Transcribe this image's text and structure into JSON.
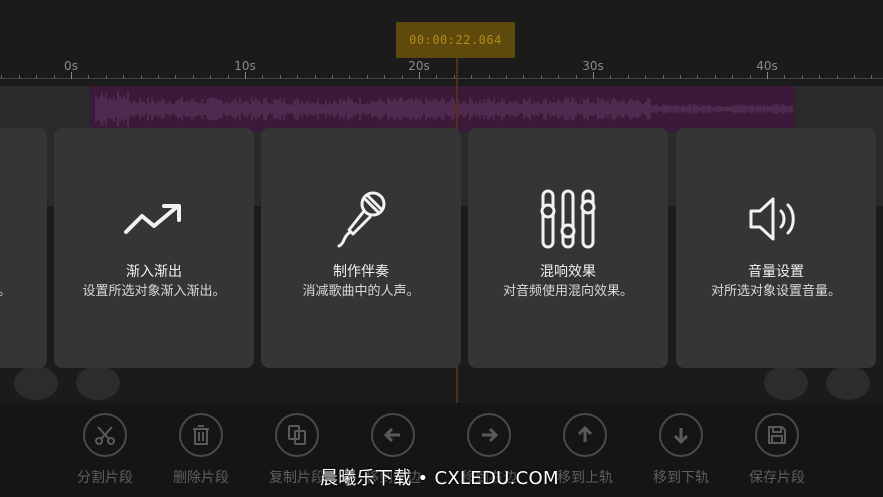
{
  "timeline": {
    "current_time": "00:00:22.064",
    "ruler_labels": [
      "0s",
      "10s",
      "20s",
      "30s",
      "40s"
    ]
  },
  "cards": [
    {
      "icon": "trend-up-icon",
      "title": "渐入渐出",
      "description": "设置所选对象渐入渐出。"
    },
    {
      "icon": "microphone-icon",
      "title": "制作伴奏",
      "description": "消减歌曲中的人声。"
    },
    {
      "icon": "sliders-icon",
      "title": "混响效果",
      "description": "对音频使用混向效果。"
    },
    {
      "icon": "speaker-icon",
      "title": "音量设置",
      "description": "对所选对象设置音量。"
    }
  ],
  "partial_card_text": "调。",
  "toolbar": [
    {
      "icon": "scissors-icon",
      "label": "分割片段"
    },
    {
      "icon": "trash-icon",
      "label": "删除片段"
    },
    {
      "icon": "copy-icon",
      "label": "复制片段"
    },
    {
      "icon": "arrow-left-icon",
      "label": "移到左边"
    },
    {
      "icon": "arrow-right-icon",
      "label": "移到右边"
    },
    {
      "icon": "arrow-up-icon",
      "label": "移到上轨"
    },
    {
      "icon": "arrow-down-icon",
      "label": "移到下轨"
    },
    {
      "icon": "save-icon",
      "label": "保存片段"
    }
  ],
  "watermark": "晨曦乐下载 • CXLEDU.COM",
  "colors": {
    "clip": "#3b1a39",
    "waveform": "#5a3258",
    "time_badge": "#5e4a0c",
    "card": "#353535"
  }
}
